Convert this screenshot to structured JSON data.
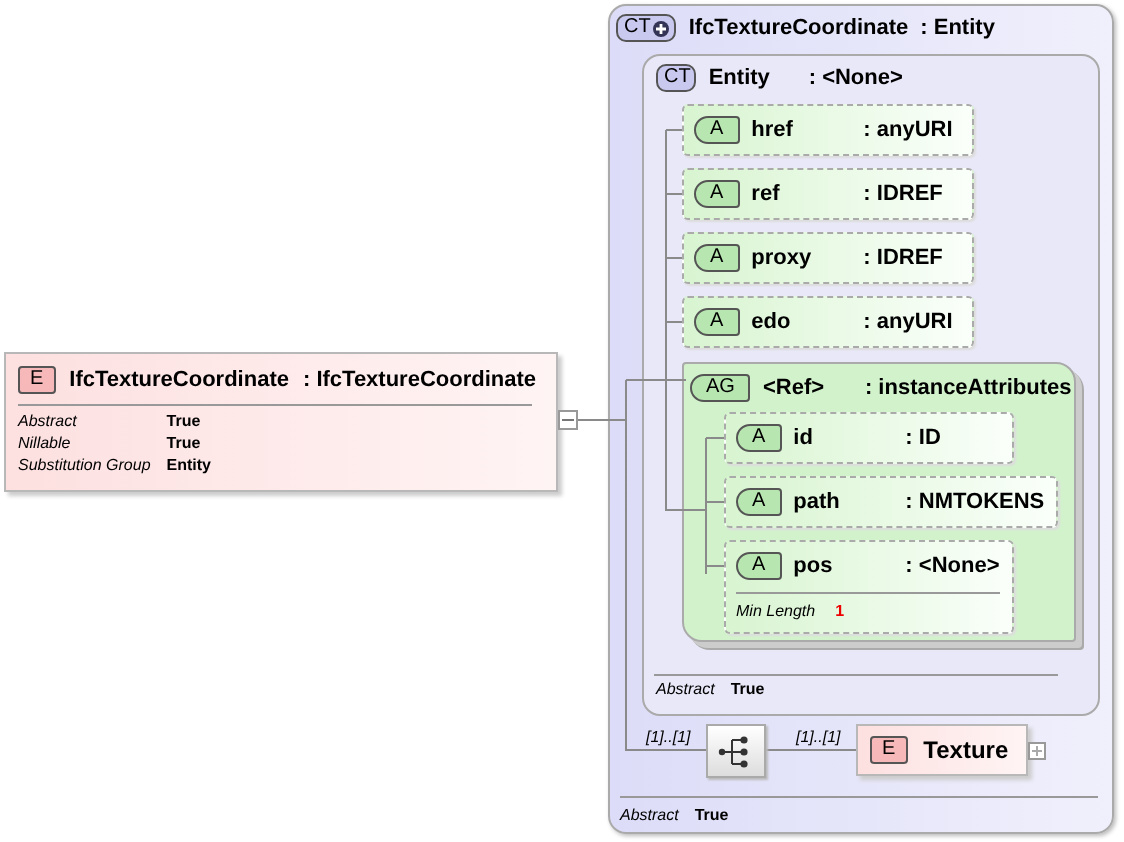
{
  "element": {
    "badge": "E",
    "name": "IfcTextureCoordinate",
    "type": ": IfcTextureCoordinate",
    "properties": [
      {
        "label": "Abstract",
        "value": "True"
      },
      {
        "label": "Nillable",
        "value": "True"
      },
      {
        "label": "Substitution Group",
        "value": "Entity"
      }
    ]
  },
  "complex_type": {
    "badge": "CT",
    "name": "IfcTextureCoordinate",
    "type": ": Entity",
    "base": {
      "badge": "CT",
      "name": "Entity",
      "type": ": <None>",
      "attributes": [
        {
          "badge": "A",
          "name": "href",
          "type": ": anyURI"
        },
        {
          "badge": "A",
          "name": "ref",
          "type": ": IDREF"
        },
        {
          "badge": "A",
          "name": "proxy",
          "type": ": IDREF"
        },
        {
          "badge": "A",
          "name": "edo",
          "type": ": anyURI"
        }
      ],
      "attribute_group": {
        "badge": "AG",
        "name": "<Ref>",
        "type": ": instanceAttributes",
        "attributes": [
          {
            "badge": "A",
            "name": "id",
            "type": ": ID"
          },
          {
            "badge": "A",
            "name": "path",
            "type": ": NMTOKENS"
          },
          {
            "badge": "A",
            "name": "pos",
            "type": ": <None>",
            "facets": [
              {
                "label": "Min Length",
                "value": "1"
              }
            ]
          }
        ]
      },
      "properties": [
        {
          "label": "Abstract",
          "value": "True"
        }
      ]
    },
    "sequence": {
      "occurs": "[1]..[1]",
      "child": {
        "occurs": "[1]..[1]",
        "badge": "E",
        "name": "Texture"
      }
    },
    "properties": [
      {
        "label": "Abstract",
        "value": "True"
      }
    ]
  }
}
